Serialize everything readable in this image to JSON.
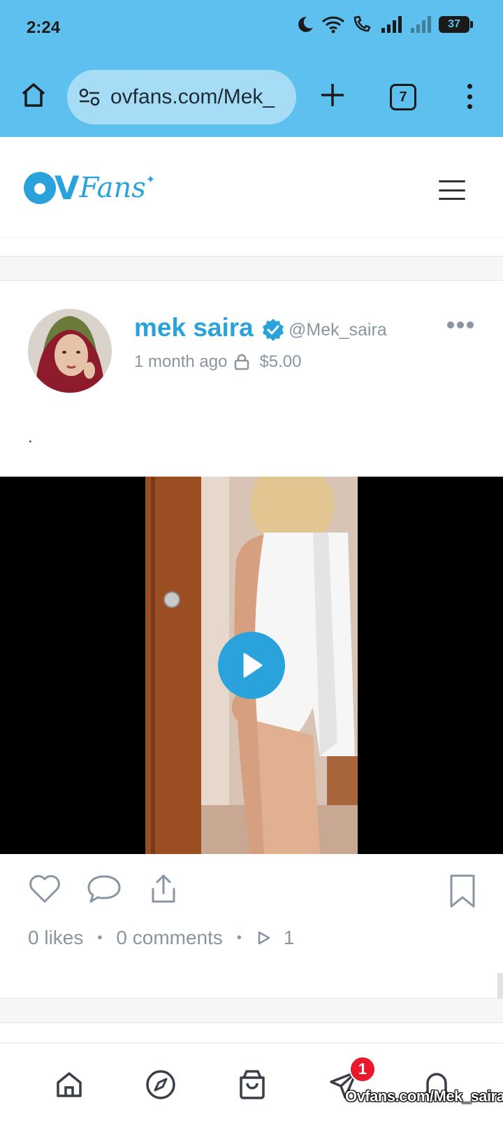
{
  "status_bar": {
    "time": "2:24",
    "battery": "37"
  },
  "browser": {
    "url": "ovfans.com/Mek_",
    "tab_count": "7"
  },
  "site": {
    "logo_text_v": "V",
    "logo_text_fans": "Fans"
  },
  "post": {
    "author_name": "mek saira",
    "handle": "@Mek_saira",
    "time_ago": "1 month ago",
    "price": "$5.00",
    "text": ".",
    "likes": "0 likes",
    "comments": "0 comments",
    "views": "1"
  },
  "bottom_nav": {
    "messages_badge": "1"
  },
  "watermark": "Ovfans.com/Mek_saira",
  "colors": {
    "chrome": "#5ec0ee",
    "brand": "#2aa3dd",
    "muted": "#8a95a2",
    "badge": "#e8192c"
  },
  "icons": [
    "home-icon",
    "site-settings-icon",
    "plus-icon",
    "tabs-icon",
    "more-vert-icon",
    "hamburger-icon",
    "verified-icon",
    "lock-icon",
    "play-icon",
    "heart-icon",
    "comment-icon",
    "share-icon",
    "bookmark-icon",
    "compass-icon",
    "bag-icon",
    "send-icon",
    "bell-icon"
  ]
}
